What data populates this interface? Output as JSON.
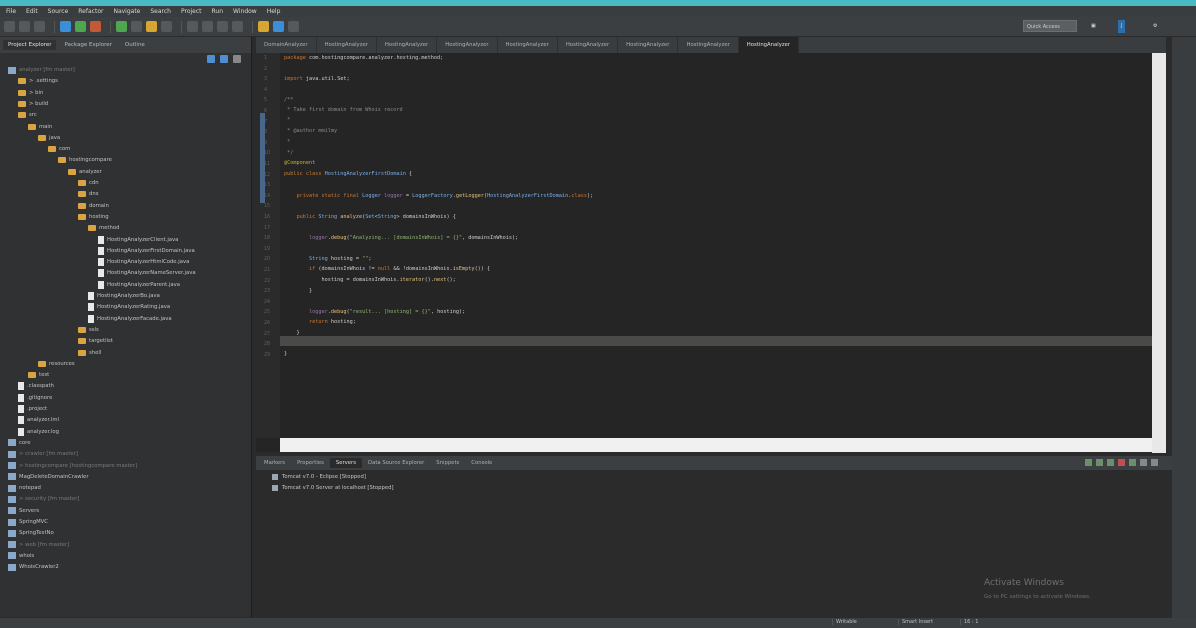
{
  "menu": [
    "File",
    "Edit",
    "Source",
    "Refactor",
    "Navigate",
    "Search",
    "Project",
    "Run",
    "Window",
    "Help"
  ],
  "toolbar": {
    "quick_access": "Quick Access"
  },
  "left_panel": {
    "tabs": [
      "Project Explorer",
      "Package Explorer",
      "Outline"
    ],
    "tree": [
      {
        "t": "analyzer [fm master]",
        "lvl": 1,
        "k": "proj"
      },
      {
        "t": "> .settings",
        "lvl": 2,
        "k": "folder"
      },
      {
        "t": "> bin",
        "lvl": 2,
        "k": "folder"
      },
      {
        "t": "> build",
        "lvl": 2,
        "k": "folder"
      },
      {
        "t": "src",
        "lvl": 2,
        "k": "folder"
      },
      {
        "t": "main",
        "lvl": 3,
        "k": "folder"
      },
      {
        "t": "java",
        "lvl": 4,
        "k": "folder"
      },
      {
        "t": "com",
        "lvl": 5,
        "k": "folder"
      },
      {
        "t": "hostingcompare",
        "lvl": 6,
        "k": "folder"
      },
      {
        "t": "analyzer",
        "lvl": 7,
        "k": "folder"
      },
      {
        "t": "cdn",
        "lvl": 8,
        "k": "folder"
      },
      {
        "t": "dns",
        "lvl": 8,
        "k": "folder"
      },
      {
        "t": "domain",
        "lvl": 8,
        "k": "folder"
      },
      {
        "t": "hosting",
        "lvl": 8,
        "k": "folder"
      },
      {
        "t": "method",
        "lvl": 9,
        "k": "folder"
      },
      {
        "t": "HostingAnalyzerClient.java",
        "lvl": 10,
        "k": "file"
      },
      {
        "t": "HostingAnalyzerFirstDomain.java",
        "lvl": 10,
        "k": "file"
      },
      {
        "t": "HostingAnalyzerHtmlCode.java",
        "lvl": 10,
        "k": "file"
      },
      {
        "t": "HostingAnalyzerNameServer.java",
        "lvl": 10,
        "k": "file"
      },
      {
        "t": "HostingAnalyzerParent.java",
        "lvl": 10,
        "k": "file"
      },
      {
        "t": "HostingAnalyzerBo.java",
        "lvl": 9,
        "k": "file"
      },
      {
        "t": "HostingAnalyzerRating.java",
        "lvl": 9,
        "k": "file"
      },
      {
        "t": "HostingAnalyzerFacade.java",
        "lvl": 9,
        "k": "file"
      },
      {
        "t": "ssls",
        "lvl": 8,
        "k": "folder"
      },
      {
        "t": "targetlist",
        "lvl": 8,
        "k": "folder"
      },
      {
        "t": "shell",
        "lvl": 8,
        "k": "folder"
      },
      {
        "t": "resources",
        "lvl": 4,
        "k": "folder"
      },
      {
        "t": "test",
        "lvl": 3,
        "k": "folder"
      },
      {
        "t": ".classpath",
        "lvl": 2,
        "k": "file"
      },
      {
        "t": ".gitignore",
        "lvl": 2,
        "k": "file"
      },
      {
        "t": ".project",
        "lvl": 2,
        "k": "file"
      },
      {
        "t": "analyzer.iml",
        "lvl": 2,
        "k": "file"
      },
      {
        "t": "analyzer.log",
        "lvl": 2,
        "k": "file"
      },
      {
        "t": "core",
        "lvl": 1,
        "k": "proj"
      },
      {
        "t": "> crawler [fm master]",
        "lvl": 1,
        "k": "proj"
      },
      {
        "t": "> hostingcompare [hostingcompare master]",
        "lvl": 1,
        "k": "proj"
      },
      {
        "t": "MagDeleteDomainCrawler",
        "lvl": 1,
        "k": "proj"
      },
      {
        "t": "notepad",
        "lvl": 1,
        "k": "proj"
      },
      {
        "t": "> security [fm master]",
        "lvl": 1,
        "k": "proj"
      },
      {
        "t": "Servers",
        "lvl": 1,
        "k": "proj"
      },
      {
        "t": "SpringMVC",
        "lvl": 1,
        "k": "proj"
      },
      {
        "t": "SpringTestNo",
        "lvl": 1,
        "k": "proj"
      },
      {
        "t": "> web [fm master]",
        "lvl": 1,
        "k": "proj"
      },
      {
        "t": "whois",
        "lvl": 1,
        "k": "proj"
      },
      {
        "t": "WhoisCrawler2",
        "lvl": 1,
        "k": "proj"
      }
    ]
  },
  "editor": {
    "tabs": [
      {
        "label": "DomainAnalyzer",
        "active": false
      },
      {
        "label": "HostingAnalyzer",
        "active": false
      },
      {
        "label": "HostingAnalyzer",
        "active": false
      },
      {
        "label": "HostingAnalyzer",
        "active": false
      },
      {
        "label": "HostingAnalyzer",
        "active": false
      },
      {
        "label": "HostingAnalyzer",
        "active": false
      },
      {
        "label": "HostingAnalyzer",
        "active": false
      },
      {
        "label": "HostingAnalyzer",
        "active": false
      },
      {
        "label": "HostingAnalyzer",
        "active": true
      }
    ],
    "line_numbers": [
      "1",
      "2",
      "3",
      "4",
      "5",
      "6",
      "7",
      "8",
      "9",
      "10",
      "11",
      "12",
      "13",
      "14",
      "15",
      "16",
      "17",
      "18",
      "19",
      "20",
      "21",
      "22",
      "23",
      "24",
      "25",
      "26",
      "27",
      "28",
      "29"
    ]
  },
  "bottom_panel": {
    "tabs": [
      "Markers",
      "Properties",
      "Servers",
      "Data Source Explorer",
      "Snippets",
      "Console"
    ],
    "servers": [
      "Tomcat v7.0 - Eclipse [Stopped]",
      "Tomcat v7.0 Server at localhost [Stopped]"
    ]
  },
  "watermark": {
    "title": "Activate Windows",
    "subtitle": "Go to PC settings to activate Windows."
  },
  "status": [
    "Writable",
    "Smart Insert",
    "16 : 1"
  ]
}
